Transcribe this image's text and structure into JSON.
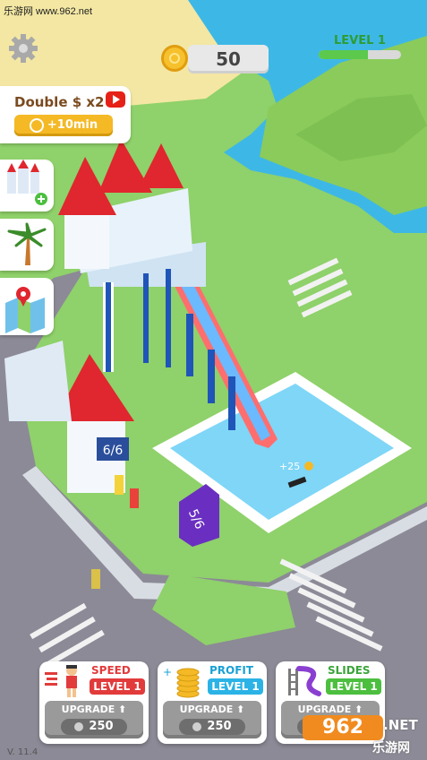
{
  "watermark": "乐游网 www.962.net",
  "coins": "50",
  "level": {
    "label": "LEVEL 1",
    "progress": 0.6
  },
  "double_offer": {
    "title": "Double $ x2",
    "button": "+10min"
  },
  "sign_pool": "5/6",
  "sign_tower": "6/6",
  "float_reward": "+25",
  "upgrades": [
    {
      "title": "SPEED",
      "level": "LEVEL 1",
      "upgrade_label": "UPGRADE",
      "price": "250",
      "title_color": "#e23b3b",
      "level_color": "#e23b3b"
    },
    {
      "title": "PROFIT",
      "level": "LEVEL 1",
      "upgrade_label": "UPGRADE",
      "price": "250",
      "title_color": "#1aa1d6",
      "level_color": "#2bb3e6"
    },
    {
      "title": "SLIDES",
      "level": "LEVEL 1",
      "upgrade_label": "UPGRADE",
      "price": "250",
      "title_color": "#3aa43a",
      "level_color": "#4cbf3f"
    }
  ],
  "version": "V. 11.4",
  "site_logo": {
    "main": "962",
    "suffix": ".NET",
    "sub": "乐游网"
  },
  "icons": [
    "gear-icon",
    "coin-icon",
    "video-icon",
    "bottles-icon",
    "palm-tree-icon",
    "map-icon",
    "runner-icon",
    "coin-stack-icon",
    "slide-icon",
    "upgrade-arrow-icon"
  ]
}
